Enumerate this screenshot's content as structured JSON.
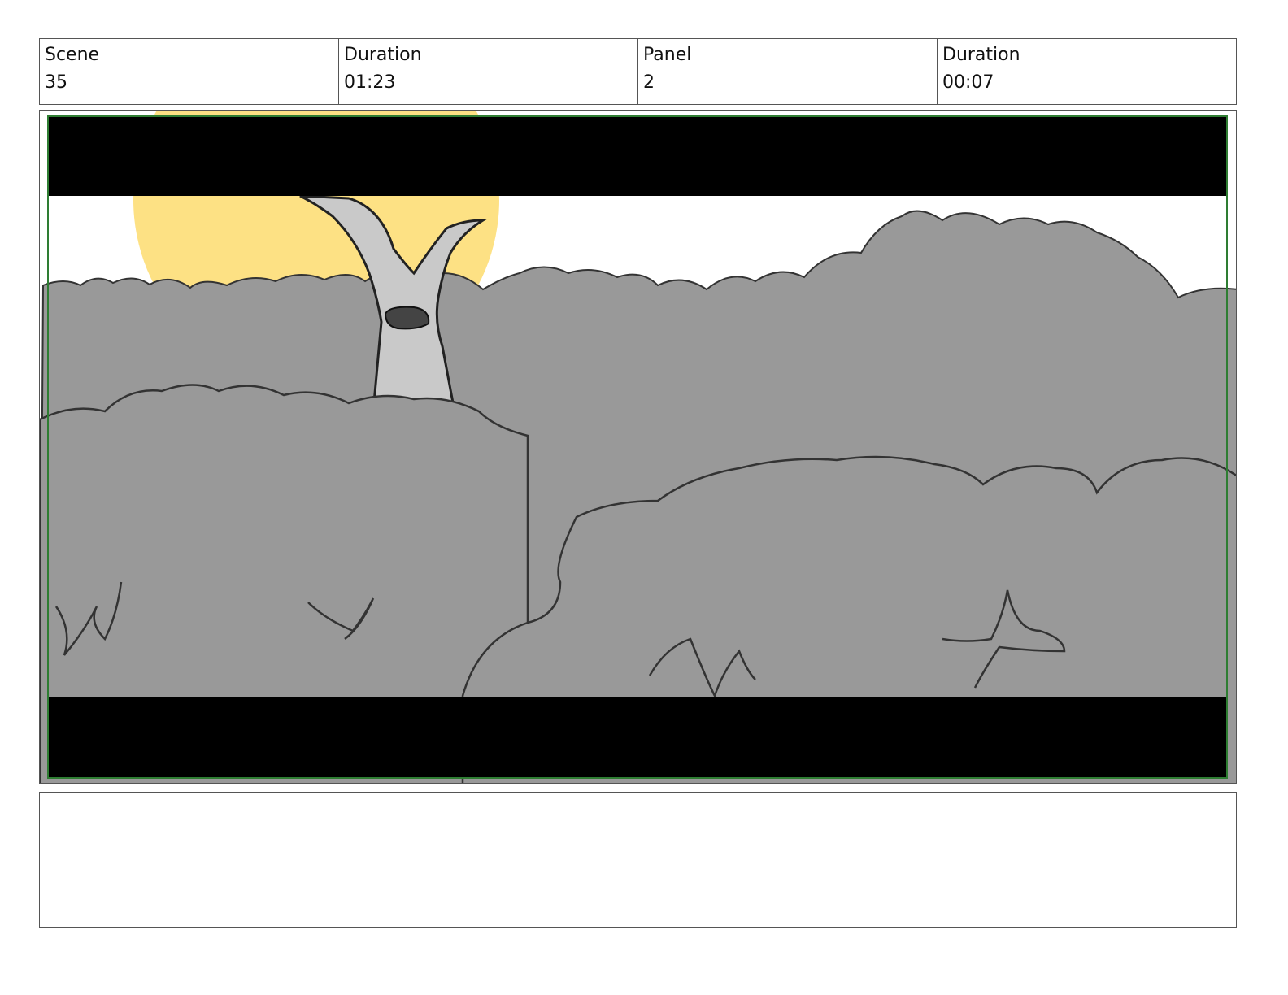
{
  "header": {
    "scene_label": "Scene",
    "scene_value": "35",
    "scene_duration_label": "Duration",
    "scene_duration_value": "01:23",
    "panel_label": "Panel",
    "panel_value": "2",
    "panel_duration_label": "Duration",
    "panel_duration_value": "00:07"
  },
  "panel_image": {
    "colors": {
      "sky": "#ffffff",
      "sun": "#fde184",
      "foliage": "#999999",
      "tree": "#c9c9c9",
      "letterbox": "#000000",
      "frame_border": "#2e7d32"
    }
  },
  "notes": {
    "text": ""
  }
}
